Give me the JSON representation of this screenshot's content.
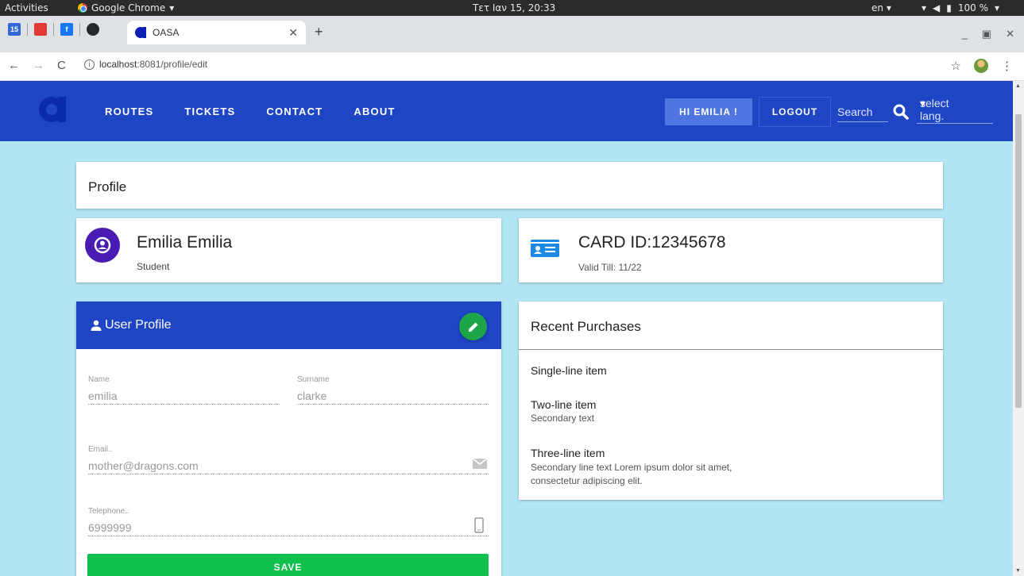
{
  "os": {
    "activities": "Activities",
    "app_name": "Google Chrome",
    "clock": "Τετ Ιαν 15, 20:33",
    "lang": "en",
    "battery": "100 %"
  },
  "browser": {
    "tab_title": "OASA",
    "pinned_calendar": "15",
    "url_host": "localhost",
    "url_rest": ":8081/profile/edit"
  },
  "nav": {
    "links": [
      "ROUTES",
      "TICKETS",
      "CONTACT",
      "ABOUT"
    ],
    "greeting": "HI EMILIA !",
    "logout": "LOGOUT",
    "search_placeholder": "Search",
    "lang_select": "select lang."
  },
  "profile": {
    "title": "Profile"
  },
  "user": {
    "name": "Emilia Emilia",
    "role": "Student"
  },
  "card": {
    "id": "CARD ID:12345678",
    "valid": "Valid Till: 11/22"
  },
  "form": {
    "title": "User Profile",
    "name_label": "Name",
    "name_value": "emilia",
    "surname_label": "Surname",
    "surname_value": "clarke",
    "email_label": "Email..",
    "email_value": "mother@dragons.com",
    "phone_label": "Telephone..",
    "phone_value": "6999999",
    "save": "SAVE"
  },
  "purchases": {
    "title": "Recent Purchases",
    "items": [
      {
        "primary": "Single-line item",
        "secondary": ""
      },
      {
        "primary": "Two-line item",
        "secondary": "Secondary text"
      },
      {
        "primary": "Three-line item",
        "secondary": "Secondary line text Lorem ipsum dolor sit amet, consectetur adipiscing elit."
      }
    ]
  },
  "colors": {
    "primary": "#1e45c3",
    "accent_green": "#0fc04c",
    "avatar_purple": "#4a1bb3",
    "background": "#b3e5f5"
  }
}
